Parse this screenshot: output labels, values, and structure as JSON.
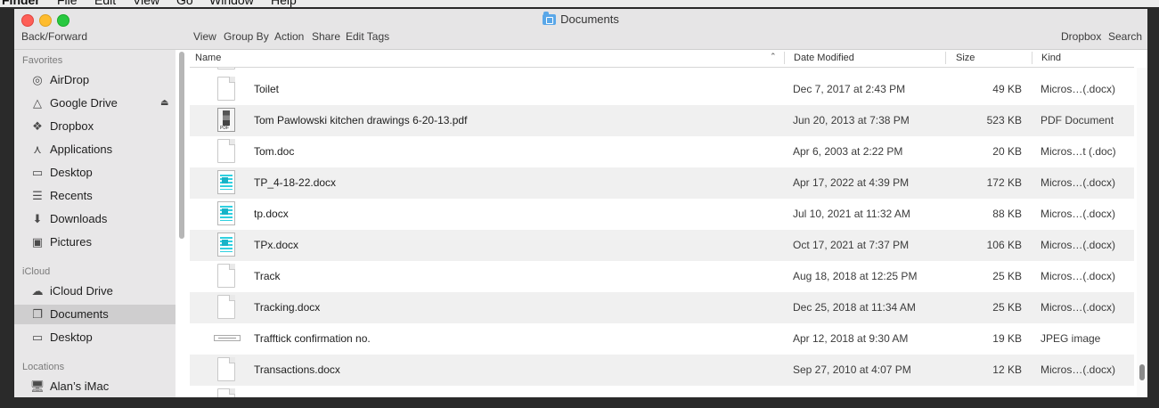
{
  "menubar": {
    "app": "Finder",
    "items": [
      "File",
      "Edit",
      "View",
      "Go",
      "Window",
      "Help"
    ]
  },
  "window": {
    "title": "Documents",
    "toolbar": {
      "back_forward": "Back/Forward",
      "view": "View",
      "group_by": "Group By",
      "action": "Action",
      "share": "Share",
      "edit_tags": "Edit Tags",
      "dropbox": "Dropbox",
      "search": "Search"
    }
  },
  "sidebar": {
    "favorites_header": "Favorites",
    "favorites": [
      {
        "label": "AirDrop",
        "icon": "airdrop-icon"
      },
      {
        "label": "Google Drive",
        "icon": "google-drive-icon"
      },
      {
        "label": "Dropbox",
        "icon": "dropbox-icon"
      },
      {
        "label": "Applications",
        "icon": "applications-icon"
      },
      {
        "label": "Desktop",
        "icon": "desktop-icon"
      },
      {
        "label": "Recents",
        "icon": "recents-icon"
      },
      {
        "label": "Downloads",
        "icon": "downloads-icon"
      },
      {
        "label": "Pictures",
        "icon": "pictures-icon"
      }
    ],
    "icloud_header": "iCloud",
    "icloud": [
      {
        "label": "iCloud Drive",
        "icon": "cloud-icon"
      },
      {
        "label": "Documents",
        "icon": "documents-icon",
        "selected": true
      },
      {
        "label": "Desktop",
        "icon": "desktop-icon"
      }
    ],
    "locations_header": "Locations",
    "locations": [
      {
        "label": "Alan’s iMac",
        "icon": "imac-icon"
      }
    ]
  },
  "columns": {
    "name": "Name",
    "date": "Date Modified",
    "size": "Size",
    "kind": "Kind"
  },
  "files": [
    {
      "name": "Toilet",
      "date": "Dec 7, 2017 at 2:43 PM",
      "size": "49 KB",
      "kind": "Micros…(.docx)",
      "icon": "blank"
    },
    {
      "name": "Tom Pawlowski kitchen drawings 6-20-13.pdf",
      "date": "Jun 20, 2013 at 7:38 PM",
      "size": "523 KB",
      "kind": "PDF Document",
      "icon": "pdf"
    },
    {
      "name": "Tom.doc",
      "date": "Apr 6, 2003 at 2:22 PM",
      "size": "20 KB",
      "kind": "Micros…t (.doc)",
      "icon": "blank"
    },
    {
      "name": "TP_4-18-22.docx",
      "date": "Apr 17, 2022 at 4:39 PM",
      "size": "172 KB",
      "kind": "Micros…(.docx)",
      "icon": "word"
    },
    {
      "name": "tp.docx",
      "date": "Jul 10, 2021 at 11:32 AM",
      "size": "88 KB",
      "kind": "Micros…(.docx)",
      "icon": "word"
    },
    {
      "name": "TPx.docx",
      "date": "Oct 17, 2021 at 7:37 PM",
      "size": "106 KB",
      "kind": "Micros…(.docx)",
      "icon": "word"
    },
    {
      "name": "Track",
      "date": "Aug 18, 2018 at 12:25 PM",
      "size": "25 KB",
      "kind": "Micros…(.docx)",
      "icon": "blank"
    },
    {
      "name": "Tracking.docx",
      "date": "Dec 25, 2018 at 11:34 AM",
      "size": "25 KB",
      "kind": "Micros…(.docx)",
      "icon": "blank"
    },
    {
      "name": "Trafftick confirmation no.",
      "date": "Apr 12, 2018 at 9:30 AM",
      "size": "19 KB",
      "kind": "JPEG image",
      "icon": "jpeg"
    },
    {
      "name": "Transactions.docx",
      "date": "Sep 27, 2010 at 4:07 PM",
      "size": "12 KB",
      "kind": "Micros…(.docx)",
      "icon": "blank"
    }
  ]
}
